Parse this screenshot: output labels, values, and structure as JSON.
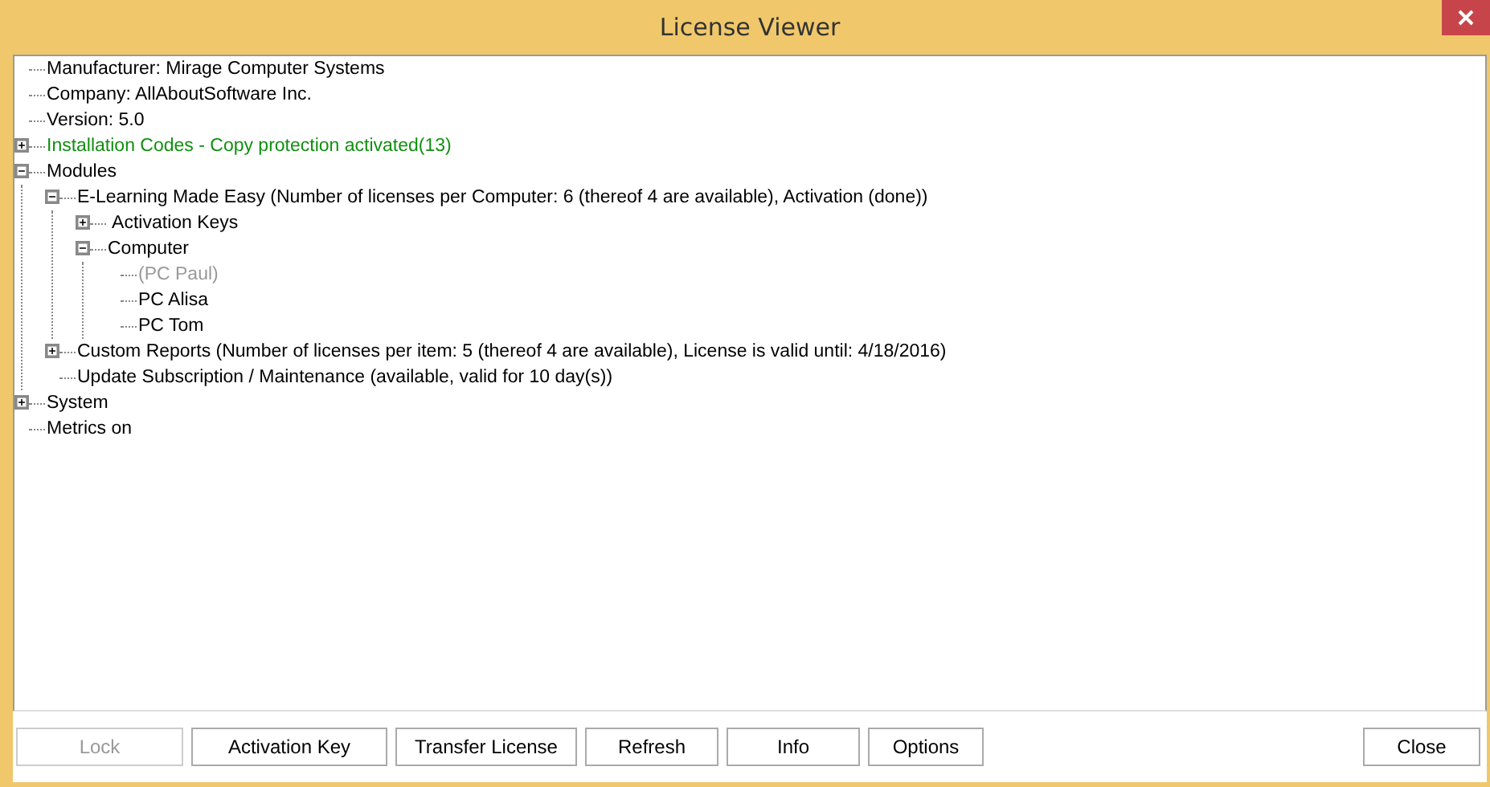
{
  "window": {
    "title": "License Viewer"
  },
  "tree": [
    {
      "label": "Manufacturer: Mirage Computer Systems"
    },
    {
      "label": "Company: AllAboutSoftware Inc."
    },
    {
      "label": "Version: 5.0"
    },
    {
      "label": "Installation Codes - Copy protection activated(13)",
      "expanded": false,
      "color": "#109010"
    },
    {
      "label": "Modules",
      "expanded": true,
      "children": [
        {
          "label": "E-Learning Made Easy (Number of licenses per Computer: 6 (thereof 4 are available), Activation (done))",
          "expanded": true,
          "children": [
            {
              "label": " Activation Keys",
              "expanded": false
            },
            {
              "label": "Computer",
              "expanded": true,
              "children": [
                {
                  "label": "(PC Paul)",
                  "disabled": true
                },
                {
                  "label": "PC Alisa",
                  "disabled": false
                },
                {
                  "label": "PC Tom",
                  "disabled": false
                }
              ]
            }
          ]
        },
        {
          "label": "Custom Reports (Number of licenses per item: 5 (thereof 4 are available), License is valid until: 4/18/2016)",
          "expanded": false
        },
        {
          "label": "Update Subscription / Maintenance (available, valid for 10 day(s))"
        }
      ]
    },
    {
      "label": "System",
      "expanded": false
    },
    {
      "label": "Metrics on"
    }
  ],
  "buttons": [
    {
      "label": "Lock",
      "disabled": true,
      "kind": "left"
    },
    {
      "label": "Activation Key",
      "disabled": false,
      "kind": "left"
    },
    {
      "label": "Transfer License",
      "disabled": false,
      "kind": "left"
    },
    {
      "label": "Refresh",
      "disabled": false,
      "kind": "left"
    },
    {
      "label": "Info",
      "disabled": false,
      "kind": "left"
    },
    {
      "label": "Options",
      "disabled": false,
      "kind": "left"
    },
    {
      "label": "Close",
      "disabled": false,
      "kind": "right"
    }
  ]
}
